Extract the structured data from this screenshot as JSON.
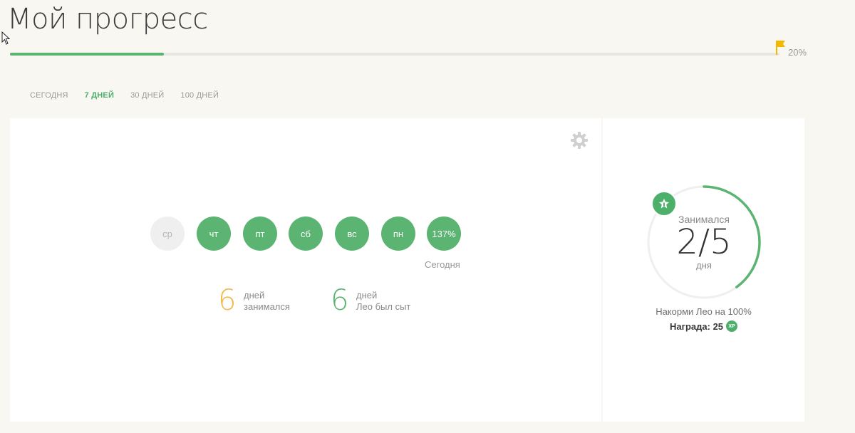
{
  "header": {
    "title": "Мой прогресс",
    "progress_percent_label": "20%",
    "progress_fraction": 0.2
  },
  "tabs": [
    {
      "label": "Сегодня",
      "active": false
    },
    {
      "label": "7 дней",
      "active": true
    },
    {
      "label": "30 дней",
      "active": false
    },
    {
      "label": "100 дней",
      "active": false
    }
  ],
  "week": {
    "days": [
      {
        "label": "ср",
        "done": false
      },
      {
        "label": "чт",
        "done": true
      },
      {
        "label": "пт",
        "done": true
      },
      {
        "label": "сб",
        "done": true
      },
      {
        "label": "вс",
        "done": true
      },
      {
        "label": "пн",
        "done": true
      },
      {
        "label": "137%",
        "done": true
      }
    ],
    "today_label": "Сегодня"
  },
  "stats": [
    {
      "value": "6",
      "line1": "дней",
      "line2": "занимался",
      "color": "#f0b94a"
    },
    {
      "value": "6",
      "line1": "дней",
      "line2": "Лео был сыт",
      "color": "#5bb471"
    }
  ],
  "goal": {
    "ring_top": "Занимался",
    "ring_value": "2/5",
    "ring_bottom": "дня",
    "ring_fraction": 0.4,
    "text": "Накорми Лео на 100%",
    "reward": "Награда: 25",
    "xp_label": "XP"
  },
  "colors": {
    "accent": "#5bb471",
    "orange": "#f0b94a",
    "flag": "#f5b800"
  },
  "icons": {
    "settings": "gear-icon",
    "goal_flag": "flag-icon",
    "badge": "star-badge-icon",
    "xp": "xp-icon"
  }
}
